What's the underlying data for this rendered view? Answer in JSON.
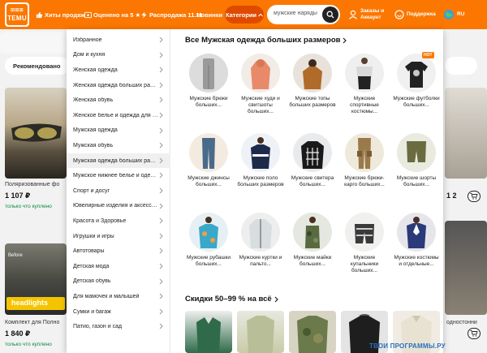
{
  "header": {
    "logo_top": "⊞⊞⊞",
    "logo_bottom": "TEMU",
    "nav": [
      {
        "label": "Хиты продаж"
      },
      {
        "label": "Оценено на 5 ★"
      },
      {
        "label": "Распродажа 11.11"
      },
      {
        "label": "Новинки"
      }
    ],
    "categories_label": "Категории",
    "search_value": "мужские наряды",
    "account_line1": "Заказы и",
    "account_line2": "Аккаунт",
    "support_label": "Поддержка",
    "lang": "RU",
    "brand_color": "#fb7701"
  },
  "background": {
    "recommended_label": "Рекомендовано",
    "product1_title": "Поляризованные фо",
    "product1_price": "1 107 ₽",
    "product1_sold": "только что куплено",
    "product2_title": "Комплект для Полно",
    "product2_price": "1 840 ₽",
    "product2_sold": "только что куплено",
    "right_title": "одностонни",
    "right_price": "1 2",
    "banner_text": "headlights",
    "banner_prefix": "Before"
  },
  "menu": {
    "categories": [
      "Избранное",
      "Дом и кухня",
      "Женская одежда",
      "Женская одежда больших размеров",
      "Женская обувь",
      "Женское белье и одежда для дома",
      "Мужская одежда",
      "Мужская обувь",
      "Мужская одежда больших размеров",
      "Мужское нижнее белье и одежда для сна",
      "Спорт и досуг",
      "Ювелирные изделия и аксессуары",
      "Красота и Здоровье",
      "Игрушки и игры",
      "Автотовары",
      "Детская мода",
      "Детская обувь",
      "Для мамочек и малышей",
      "Сумки и багаж",
      "Патио, газон и сад"
    ],
    "active_index": 8,
    "section_title": "Все Мужская одежда больших размеров",
    "hot_badge": "HOT",
    "subcategories": [
      {
        "label": "Мужские брюки больших...",
        "icon": "pants-icon"
      },
      {
        "label": "Мужские худи и свитшоты больших...",
        "icon": "hoodie-icon"
      },
      {
        "label": "Мужские топы больших размеров",
        "icon": "top-icon"
      },
      {
        "label": "Мужские спортивные костюмы...",
        "icon": "tracksuit-icon"
      },
      {
        "label": "Мужские футболки больших...",
        "icon": "tshirt-icon"
      },
      {
        "label": "Мужские джинсы больших...",
        "icon": "jeans-icon"
      },
      {
        "label": "Мужские поло больших размеров",
        "icon": "polo-icon"
      },
      {
        "label": "Мужские свитера больших...",
        "icon": "sweater-icon"
      },
      {
        "label": "Мужские брюки-карго больших...",
        "icon": "cargo-icon"
      },
      {
        "label": "Мужские шорты больших...",
        "icon": "shorts-icon"
      },
      {
        "label": "Мужские рубашки больших...",
        "icon": "shirt-icon"
      },
      {
        "label": "Мужские куртки и пальто...",
        "icon": "jacket-icon"
      },
      {
        "label": "Мужские майки больших...",
        "icon": "tank-icon"
      },
      {
        "label": "Мужские купальники больших...",
        "icon": "swim-icon"
      },
      {
        "label": "Мужские костюмы и отдельные...",
        "icon": "suit-icon"
      }
    ],
    "deals_title": "Скидки 50–99 % на всё"
  },
  "watermark": "ТВОИ ПРОГРАММЫ.РУ"
}
